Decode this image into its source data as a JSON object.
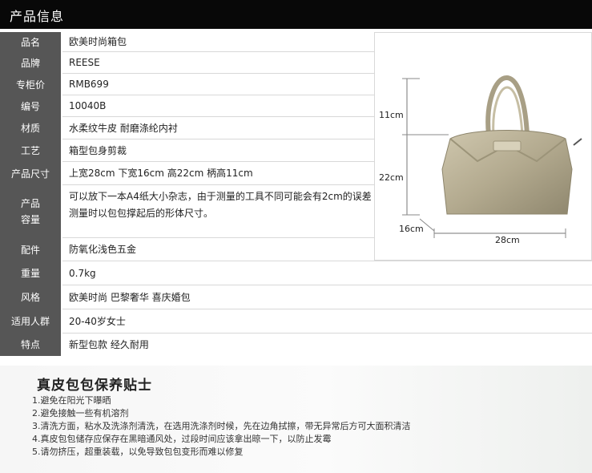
{
  "header": {
    "title": "产品信息"
  },
  "specs": [
    {
      "label": "品名",
      "value": "欧美时尚箱包"
    },
    {
      "label": "品牌",
      "value": "REESE"
    },
    {
      "label": "专柜价",
      "value": "RMB699"
    },
    {
      "label": "编号",
      "value": "10040B"
    },
    {
      "label": "材质",
      "value": "水柔纹牛皮 耐磨涤纶内衬"
    },
    {
      "label": "工艺",
      "value": "箱型包身剪裁"
    },
    {
      "label": "产品尺寸",
      "value": "上宽28cm 下宽16cm 高22cm 柄高11cm"
    },
    {
      "label_line1": "产品",
      "label_line2": "容量",
      "value_line1": "可以放下一本A4纸大小杂志，由于测量的工具不同可能会有2cm的误差",
      "value_line2": "测量时以包包撑起后的形体尺寸。"
    },
    {
      "label": "配件",
      "value": "防氧化浅色五金"
    },
    {
      "label": "重量",
      "value": "0.7kg"
    },
    {
      "label": "风格",
      "value": "欧美时尚 巴黎奢华 喜庆婚包"
    },
    {
      "label": "适用人群",
      "value": "20-40岁女士"
    },
    {
      "label": "特点",
      "value": "新型包款 经久耐用"
    }
  ],
  "photo": {
    "handle_height": "11cm",
    "body_height": "22cm",
    "bottom_width": "16cm",
    "top_width": "28cm",
    "bag_color": "#bdb49a"
  },
  "care": {
    "title": "真皮包包保养贴士",
    "items": [
      "1.避免在阳光下曝晒",
      "2.避免接触一些有机溶剂",
      "3.清洗方面，粘水及洗涤剂清洗，在选用洗涤剂时候，先在边角拭擦，带无异常后方可大面积清洁",
      "4.真皮包包储存应保存在黑暗通风处，过段时间应该拿出晾一下，以防止发霉",
      "5.请勿挤压，超重装载，以免导致包包变形而难以修复"
    ]
  }
}
